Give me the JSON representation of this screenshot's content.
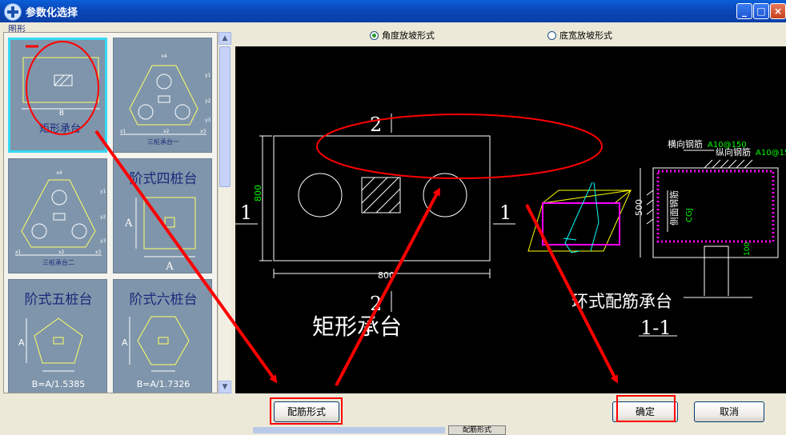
{
  "window": {
    "title": "参数化选择",
    "min_glyph": "_",
    "max_glyph": "□",
    "close_glyph": "×"
  },
  "group_label": "图形",
  "thumbnails": [
    {
      "label": "矩形承台",
      "dim_b": "B"
    },
    {
      "label": "三桩承台一",
      "dims": [
        "x4",
        "y1",
        "y2",
        "y3",
        "x1",
        "x2",
        "x3"
      ]
    },
    {
      "label": "三桩承台二",
      "dims": [
        "x4",
        "y1",
        "y2",
        "y3",
        "x1",
        "x2",
        "x3"
      ]
    },
    {
      "label": "阶式四桩台",
      "dim_a1": "A",
      "dim_a2": "A"
    },
    {
      "label": "阶式五桩台",
      "dim_a": "A",
      "formula": "B=A/1.5385"
    },
    {
      "label": "阶式六桩台",
      "dim_a": "A",
      "formula": "B=A/1.7326"
    }
  ],
  "radios": [
    {
      "label": "角度放坡形式",
      "checked": true
    },
    {
      "label": "底宽放坡形式",
      "checked": false
    }
  ],
  "drawing": {
    "dim_800_left": "800",
    "dim_800_bottom": "800",
    "section_marks": [
      "2",
      "1",
      "1",
      "2"
    ],
    "name_cn": "矩形承台",
    "ring_title": "环式配筋承台",
    "section_label": "1-1",
    "dim_500": "500",
    "dim_100": "100",
    "lbl_transverse": "横向钢筋",
    "lbl_transverse_val": "A10@150",
    "lbl_longitudinal": "纵向钢筋",
    "lbl_longitudinal_val": "A10@15",
    "lbl_side": "侧面钢筋",
    "lbl_cgj": "CGJ"
  },
  "buttons": {
    "rebar_form": "配筋形式",
    "ok": "确定",
    "cancel": "取消"
  },
  "taskbar_fragment": "配筋形式",
  "colors": {
    "annotation": "#ff0000",
    "cad_yellow": "#ffff00",
    "cad_green": "#00ff00",
    "cad_magenta": "#ff00ff",
    "cad_cyan": "#00ffff"
  }
}
